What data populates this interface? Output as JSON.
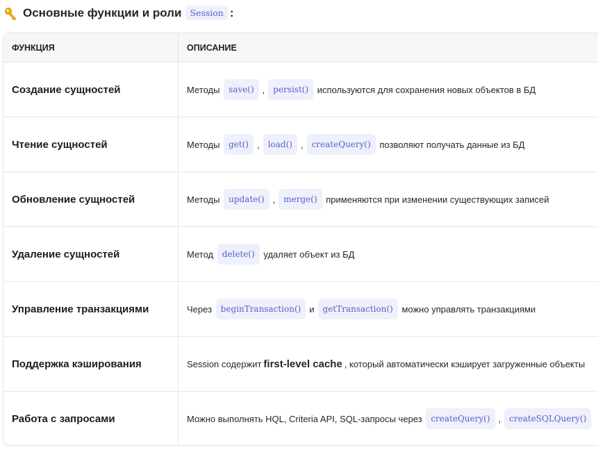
{
  "heading": {
    "text": "Основные функции и роли",
    "code": "Session",
    "colon": ":"
  },
  "table": {
    "headers": {
      "function": "ФУНКЦИЯ",
      "description": "ОПИСАНИЕ"
    },
    "rows": [
      {
        "function": "Создание сущностей",
        "pre": "Методы",
        "code1": "save()",
        "sep1": ",",
        "code2": "persist()",
        "post": "используются для сохранения новых объектов в БД"
      },
      {
        "function": "Чтение сущностей",
        "pre": "Методы",
        "code1": "get()",
        "sep1": ",",
        "code2": "load()",
        "sep2": ",",
        "code3": "createQuery()",
        "post": "позволяют получать данные из БД"
      },
      {
        "function": "Обновление сущностей",
        "pre": "Методы",
        "code1": "update()",
        "sep1": ",",
        "code2": "merge()",
        "post": "применяются при изменении существующих записей"
      },
      {
        "function": "Удаление сущностей",
        "pre": "Метод",
        "code1": "delete()",
        "post": "удаляет объект из БД"
      },
      {
        "function": "Управление транзакциями",
        "pre": "Через",
        "code1": "beginTransaction()",
        "sep1": "и",
        "code2": "getTransaction()",
        "post": "можно управлять транзакциями"
      },
      {
        "function": "Поддержка кэширования",
        "pre": "Session содержит",
        "bold": "first-level cache",
        "post": ", который автоматически кэширует загруженные объекты"
      },
      {
        "function": "Работа с запросами",
        "pre": "Можно выполнять HQL, Criteria API, SQL-запросы через",
        "code1": "createQuery()",
        "sep1": ",",
        "code2": "createSQLQuery()"
      }
    ]
  },
  "colors": {
    "code_bg": "#eef0fb",
    "code_text": "#5860c7",
    "header_bg": "#f7f7f8"
  },
  "icons": {
    "heading_icon": "key-icon"
  }
}
